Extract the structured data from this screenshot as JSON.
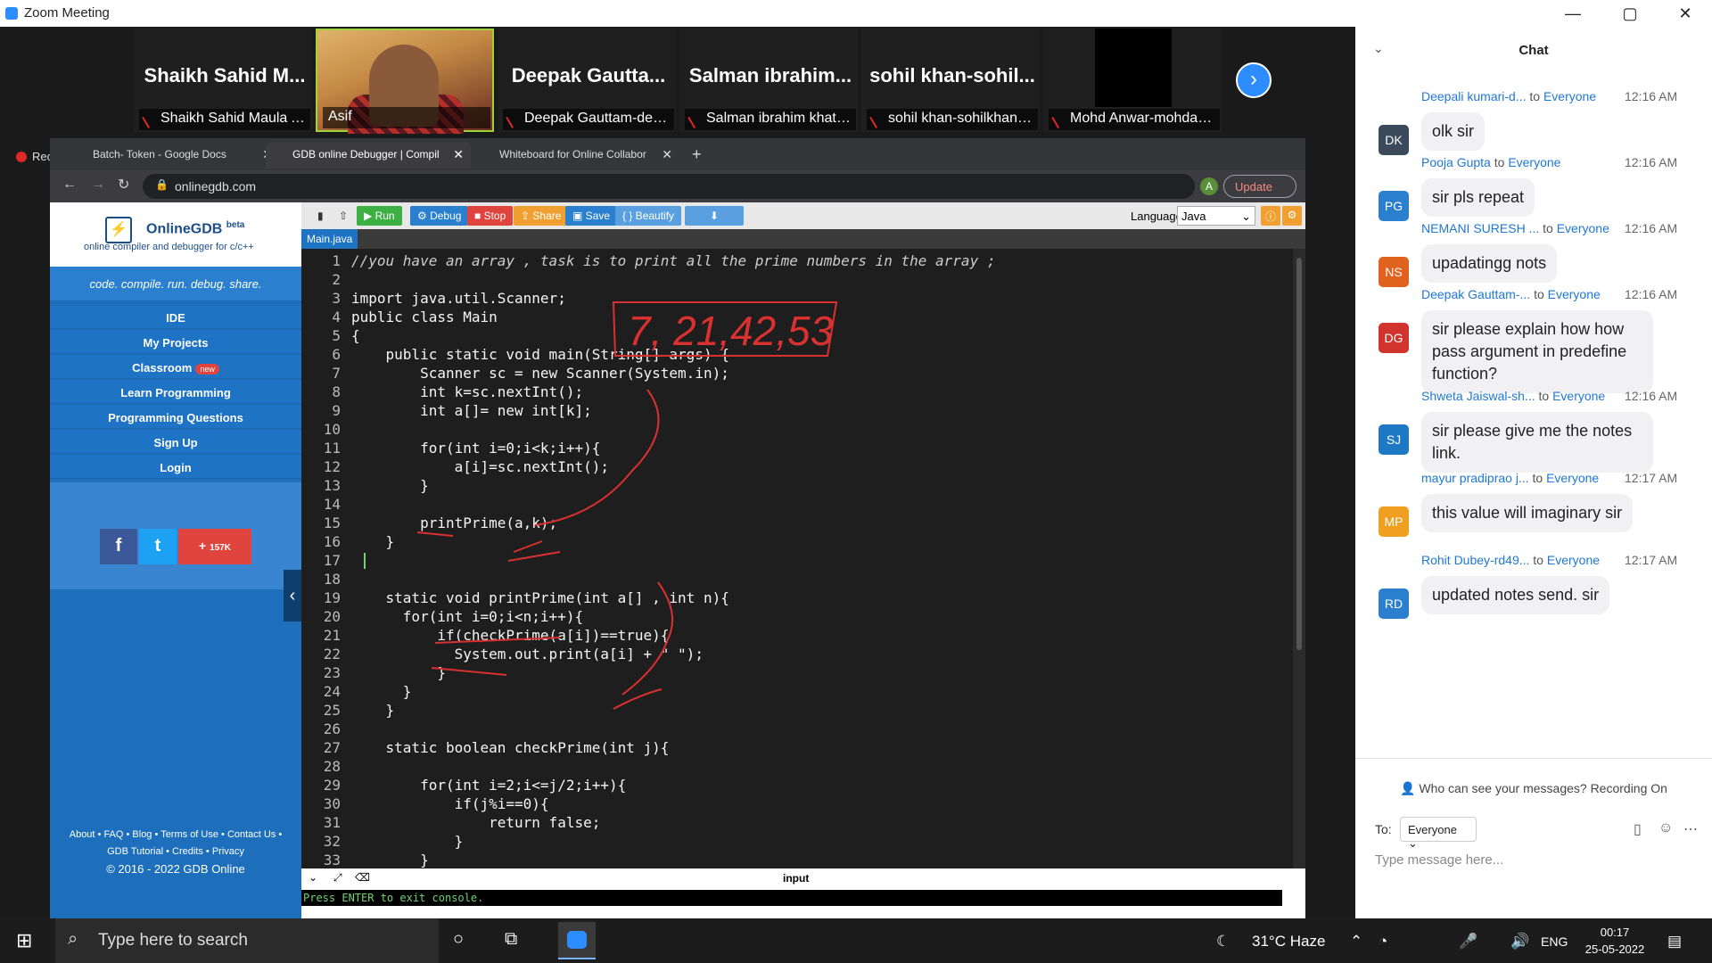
{
  "window": {
    "title": "Zoom Meeting",
    "controls": [
      "—",
      "▢",
      "✕"
    ]
  },
  "participants": [
    {
      "name": "Shaikh Sahid M...",
      "label": "Shaikh Sahid Maula Ali...",
      "muted": true
    },
    {
      "name": "",
      "label": "Asif",
      "muted": false,
      "video": true
    },
    {
      "name": "Deepak Gautta...",
      "label": "Deepak Gauttam-deep...",
      "muted": true
    },
    {
      "name": "Salman ibrahim...",
      "label": "Salman ibrahim khatik...",
      "muted": true
    },
    {
      "name": "sohil khan-sohil...",
      "label": "sohil khan-sohilkhanc...",
      "muted": true
    },
    {
      "name": "",
      "label": "Mohd Anwar-mohdan...",
      "muted": true
    }
  ],
  "recording": "Recording",
  "browser": {
    "tabs": [
      {
        "label": "Batch- Token - Google Docs"
      },
      {
        "label": "GDB online Debugger | Compil"
      },
      {
        "label": "Whiteboard for Online Collabor"
      }
    ],
    "new_tab": "+",
    "url": "onlinegdb.com",
    "update": "Update",
    "avatar": "A"
  },
  "gdb": {
    "brand": "OnlineGDB",
    "beta": "beta",
    "subtitle": "online compiler and debugger for c/c++",
    "tagline": "code. compile. run. debug. share.",
    "nav": [
      "IDE",
      "My Projects",
      "Classroom",
      "Learn Programming",
      "Programming Questions",
      "Sign Up",
      "Login"
    ],
    "new_badge": "new",
    "social": {
      "fb": "f",
      "tw": "t",
      "plus": "+",
      "count": "157K"
    },
    "footer": [
      "About • FAQ • Blog • Terms of Use • Contact Us •",
      "GDB Tutorial • Credits • Privacy",
      "© 2016 - 2022 GDB Online"
    ]
  },
  "toolbar": {
    "run": "▶ Run",
    "debug": "⚙ Debug",
    "stop": "■ Stop",
    "share": "⇪ Share",
    "save": "▣ Save",
    "beautify": "{ } Beautify",
    "download": "⬇",
    "language_label": "Language",
    "language": "Java"
  },
  "file": "Main.java",
  "code": [
    "//you have an array , task is to print all the prime numbers in the array ;",
    "",
    "import java.util.Scanner;",
    "public class Main",
    "{",
    "    public static void main(String[] args) {",
    "        Scanner sc = new Scanner(System.in);",
    "        int k=sc.nextInt();",
    "        int a[]= new int[k];",
    "",
    "        for(int i=0;i<k;i++){",
    "            a[i]=sc.nextInt();",
    "        }",
    "",
    "        printPrime(a,k);",
    "    }",
    "",
    "",
    "    static void printPrime(int a[] , int n){",
    "      for(int i=0;i<n;i++){",
    "          if(checkPrime(a[i])==true){",
    "            System.out.print(a[i] + \" \");",
    "          }",
    "      }",
    "    }",
    "",
    "    static boolean checkPrime(int j){",
    "",
    "        for(int i=2;i<=j/2;i++){",
    "            if(j%i==0){",
    "                return false;",
    "            }",
    "        }"
  ],
  "annotation": "7, 21,42,53",
  "console": {
    "label": "input",
    "text": "Press ENTER to exit console."
  },
  "chat": {
    "title": "Chat",
    "messages": [
      {
        "from": "Deepali kumari-d...",
        "to": "Everyone",
        "time": "12:16 AM",
        "initials": "DK",
        "color": "#3a4a5a",
        "text": "olk sir"
      },
      {
        "from": "Pooja Gupta",
        "to": "Everyone",
        "time": "12:16 AM",
        "initials": "PG",
        "color": "#2a7fce",
        "text": "sir pls repeat"
      },
      {
        "from": "NEMANI SURESH ...",
        "to": "Everyone",
        "time": "12:16 AM",
        "initials": "NS",
        "color": "#e0621e",
        "text": "upadatingg nots"
      },
      {
        "from": "Deepak Gauttam-...",
        "to": "Everyone",
        "time": "12:16 AM",
        "initials": "DG",
        "color": "#d0342c",
        "text": "sir please explain how how pass argument in predefine function?"
      },
      {
        "from": "Shweta Jaiswal-sh...",
        "to": "Everyone",
        "time": "12:16 AM",
        "initials": "SJ",
        "color": "#1e78c4",
        "text": "sir please give me the notes link."
      },
      {
        "from": "mayur pradiprao j...",
        "to": "Everyone",
        "time": "12:17 AM",
        "initials": "MP",
        "color": "#f0a020",
        "text": "this value will imaginary sir"
      },
      {
        "from": "Rohit Dubey-rd49...",
        "to": "Everyone",
        "time": "12:17 AM",
        "initials": "RD",
        "color": "#2a7fce",
        "text": "updated notes send. sir"
      }
    ],
    "note": "Who can see your messages? Recording On",
    "to_label": "To:",
    "to_value": "Everyone",
    "placeholder": "Type message here..."
  },
  "taskbar": {
    "search": "Type here to search",
    "weather": "31°C  Haze",
    "lang": "ENG",
    "time": "00:17",
    "date": "25-05-2022"
  }
}
